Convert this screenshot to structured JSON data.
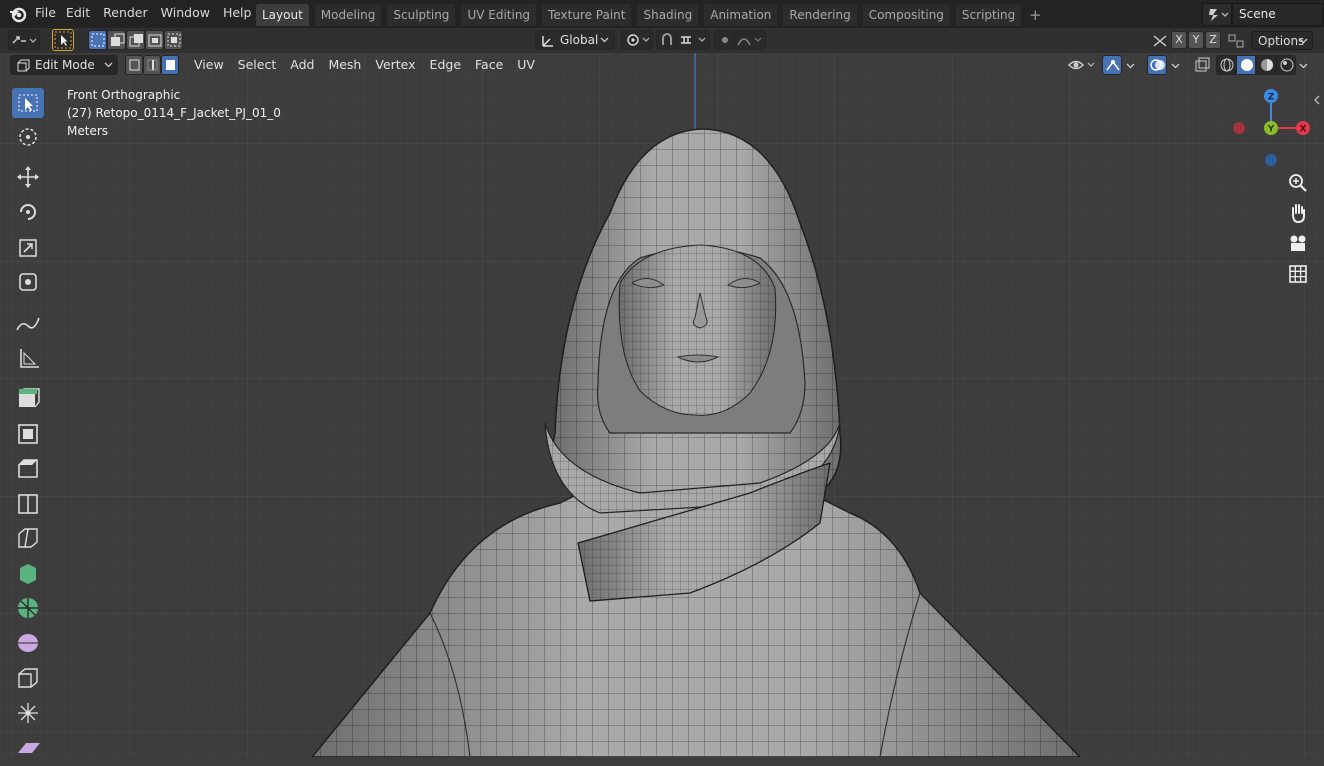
{
  "app": {
    "name": "Blender"
  },
  "menu": [
    "File",
    "Edit",
    "Render",
    "Window",
    "Help"
  ],
  "workspaces": [
    "Layout",
    "Modeling",
    "Sculpting",
    "UV Editing",
    "Texture Paint",
    "Shading",
    "Animation",
    "Rendering",
    "Compositing",
    "Scripting"
  ],
  "active_workspace": "Layout",
  "scene": {
    "name": "Scene"
  },
  "header": {
    "orientation": "Global",
    "axes": [
      "X",
      "Y",
      "Z"
    ],
    "options_label": "Options"
  },
  "viewport_header": {
    "mode": "Edit Mode",
    "menus": [
      "View",
      "Select",
      "Add",
      "Mesh",
      "Vertex",
      "Edge",
      "Face",
      "UV"
    ]
  },
  "overlay_text": {
    "view": "Front Orthographic",
    "object": "(27) Retopo_0114_F_Jacket_PJ_01_0",
    "units": "Meters"
  },
  "gizmo": {
    "z": "Z",
    "y": "Y",
    "x": "X"
  },
  "tools": [
    "select-box",
    "cursor",
    "move",
    "rotate",
    "scale",
    "transform",
    "annotate",
    "measure",
    "extrude",
    "inset",
    "bevel",
    "loop-cut",
    "knife",
    "poly-build",
    "spin",
    "smooth",
    "edge-slide",
    "shrink-fatten",
    "shear"
  ],
  "colors": {
    "accent": "#4772b3",
    "x_axis": "#e2394c",
    "y_axis": "#8bbd2c",
    "z_axis": "#3c8be2"
  }
}
